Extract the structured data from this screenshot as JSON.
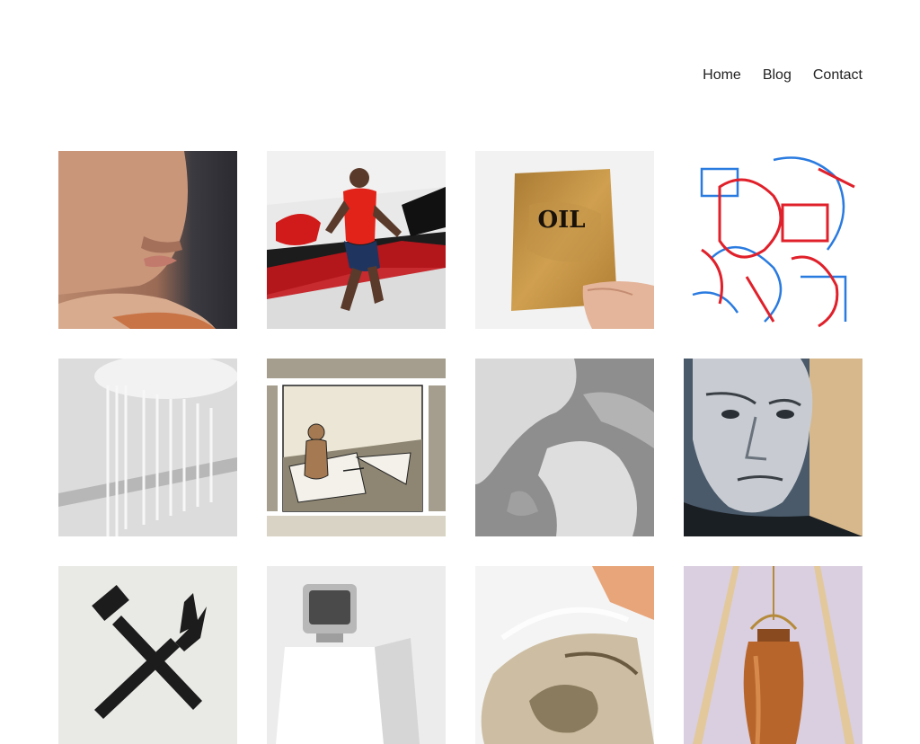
{
  "nav": {
    "items": [
      {
        "label": "Home"
      },
      {
        "label": "Blog"
      },
      {
        "label": "Contact"
      }
    ]
  },
  "gallery": {
    "tiles": [
      {
        "subject": "painted face portrait",
        "icon": "face-painting-thumbnail"
      },
      {
        "subject": "red runner mural",
        "icon": "runner-mural-thumbnail"
      },
      {
        "subject": "oil booklet in hand",
        "icon": "oil-booklet-thumbnail",
        "text": "OIL"
      },
      {
        "subject": "red and blue line drawing",
        "icon": "line-drawing-thumbnail"
      },
      {
        "subject": "grey sculpture with rods",
        "icon": "rods-sculpture-thumbnail"
      },
      {
        "subject": "comic panel with child",
        "icon": "comic-panel-thumbnail"
      },
      {
        "subject": "grey map painting",
        "icon": "map-painting-thumbnail"
      },
      {
        "subject": "elderly man portrait",
        "icon": "man-portrait-thumbnail"
      },
      {
        "subject": "crossed brush and fork symbol",
        "icon": "crossed-tools-thumbnail"
      },
      {
        "subject": "tv on pedestal",
        "icon": "tv-pedestal-thumbnail"
      },
      {
        "subject": "plastic bag of figures",
        "icon": "plastic-bag-thumbnail"
      },
      {
        "subject": "copper lantern on wooden stand",
        "icon": "copper-lantern-thumbnail"
      }
    ]
  }
}
